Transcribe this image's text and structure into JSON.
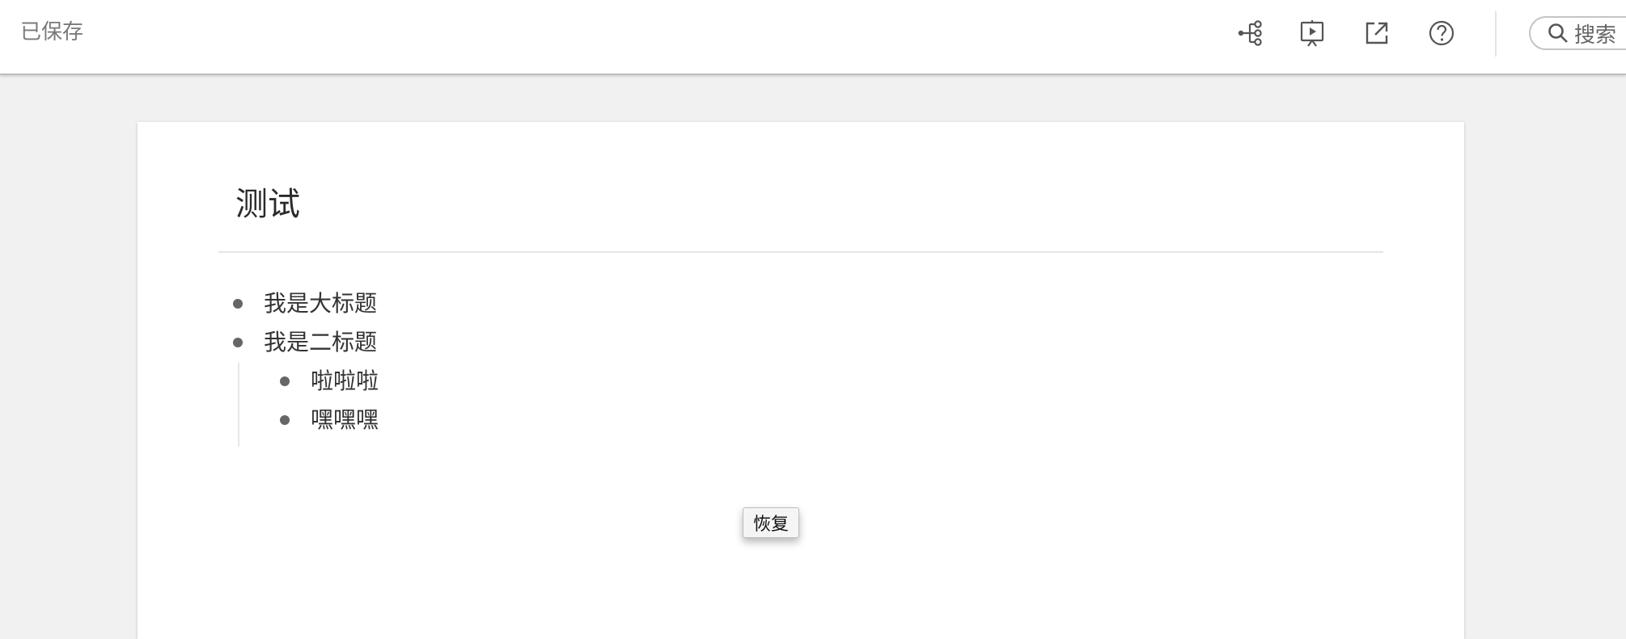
{
  "header": {
    "save_status": "已保存",
    "search": {
      "label": "搜索"
    },
    "tools": [
      {
        "name": "mindmap-icon"
      },
      {
        "name": "presentation-icon"
      },
      {
        "name": "open-external-icon"
      },
      {
        "name": "help-icon"
      }
    ]
  },
  "document": {
    "title": "测试",
    "outline": [
      {
        "text": "我是大标题",
        "level": 0
      },
      {
        "text": "我是二标题",
        "level": 0
      },
      {
        "text": "啦啦啦",
        "level": 1
      },
      {
        "text": "嘿嘿嘿",
        "level": 1
      }
    ],
    "restore_label": "恢复"
  },
  "colors": {
    "background": "#f1f1f1",
    "page": "#ffffff",
    "text": "#333333",
    "muted_text": "#7a7a7a",
    "bullet": "#666666"
  }
}
